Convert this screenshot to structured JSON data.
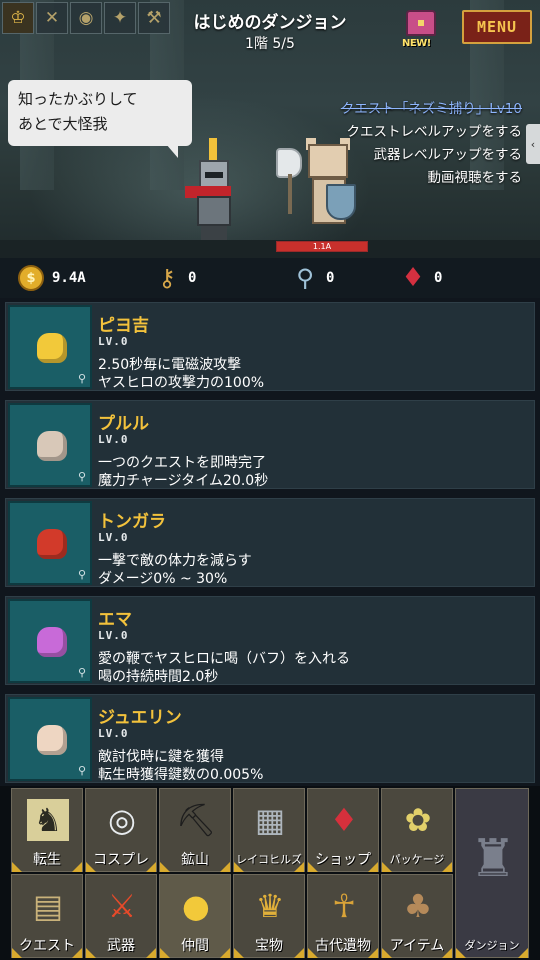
{
  "header": {
    "dungeon_title": "はじめのダンジョン",
    "floor": "1階 5/5",
    "new_badge": "NEW!",
    "menu_label": "MENU",
    "skill_slots": [
      "crown-icon",
      "crossed-swords-icon",
      "coin-icon",
      "bird-icon",
      "scroll-icon"
    ]
  },
  "scene": {
    "speech_line1": "知ったかぶりして",
    "speech_line2": "あとで大怪我",
    "quest_done": "クエスト「ネズミ捕り」Lv10",
    "quest_lines": [
      "クエストレベルアップをする",
      "武器レベルアップをする",
      "動画視聴をする"
    ],
    "enemy_hp_text": "1.1A",
    "enemy_hp_fraction": 1.0
  },
  "resources": {
    "gold": "9.4A",
    "key": "0",
    "wand": "0",
    "gem": "0"
  },
  "companions": [
    {
      "name": "ピヨ吉",
      "level": "LV.0",
      "desc1": "2.50秒毎に電磁波攻撃",
      "desc2": "ヤスヒロの攻撃力の100%",
      "color": "#f2c93a"
    },
    {
      "name": "プルル",
      "level": "LV.0",
      "desc1": "一つのクエストを即時完了",
      "desc2": "魔力チャージタイム20.0秒",
      "color": "#d8c8b8"
    },
    {
      "name": "トンガラ",
      "level": "LV.0",
      "desc1": "一撃で敵の体力を減らす",
      "desc2": "ダメージ0% ~ 30%",
      "color": "#d23a2a"
    },
    {
      "name": "エマ",
      "level": "LV.0",
      "desc1": "愛の鞭でヤスヒロに喝（バフ）を入れる",
      "desc2": "喝の持続時間2.0秒",
      "color": "#c86ad8"
    },
    {
      "name": "ジュエリン",
      "level": "LV.0",
      "desc1": "敵討伐時に鍵を獲得",
      "desc2": "転生時獲得鍵数の0.005%",
      "color": "#eed6c2"
    }
  ],
  "nav": {
    "row1": [
      {
        "label": "転生",
        "icon": "rebirth-icon",
        "glyph": "♞"
      },
      {
        "label": "コスプレ",
        "icon": "mask-icon",
        "glyph": "◎"
      },
      {
        "label": "鉱山",
        "icon": "pickaxe-icon",
        "glyph": "⛏"
      },
      {
        "label": "レイコヒルズ",
        "icon": "building-icon",
        "glyph": "▦"
      },
      {
        "label": "ショップ",
        "icon": "ruby-icon",
        "glyph": "♦"
      },
      {
        "label": "パッケージ",
        "icon": "package-icon",
        "glyph": "✿"
      }
    ],
    "row2": [
      {
        "label": "クエスト",
        "icon": "quest-scroll-icon",
        "glyph": "▤"
      },
      {
        "label": "武器",
        "icon": "sword-icon",
        "glyph": "⚔"
      },
      {
        "label": "仲間",
        "icon": "chick-icon",
        "glyph": "●"
      },
      {
        "label": "宝物",
        "icon": "treasure-icon",
        "glyph": "♛"
      },
      {
        "label": "古代遺物",
        "icon": "relic-icon",
        "glyph": "☥"
      },
      {
        "label": "アイテム",
        "icon": "bag-icon",
        "glyph": "♣"
      }
    ],
    "dungeon": {
      "label": "ダンジョン",
      "icon": "dungeon-tower-icon",
      "glyph": "♜"
    }
  },
  "colors": {
    "accent_gold": "#f3c23c",
    "menu_bg": "#7a2218",
    "card_bg": "#223038",
    "portrait_bg": "#1a5e66"
  }
}
